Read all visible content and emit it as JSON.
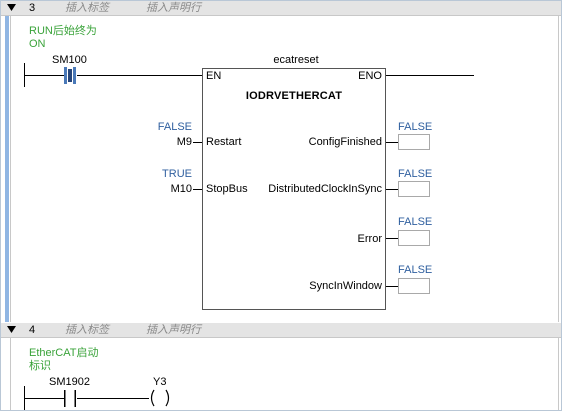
{
  "rungs": [
    {
      "number": "3",
      "insert_label": "插入标签",
      "insert_declaration": "插入声明行",
      "comment_line1": "RUN后始终为",
      "comment_line2": "ON",
      "contact": "SM100",
      "block": {
        "instance": "ecatreset",
        "type": "IODRVETHERCAT",
        "en": "EN",
        "eno": "ENO",
        "inputs": [
          {
            "pin": "Restart",
            "variable": "M9",
            "value": "FALSE"
          },
          {
            "pin": "StopBus",
            "variable": "M10",
            "value": "TRUE"
          }
        ],
        "outputs": [
          {
            "pin": "ConfigFinished",
            "value": "FALSE"
          },
          {
            "pin": "DistributedClockInSync",
            "value": "FALSE"
          },
          {
            "pin": "Error",
            "value": "FALSE"
          },
          {
            "pin": "SyncInWindow",
            "value": "FALSE"
          }
        ]
      }
    },
    {
      "number": "4",
      "insert_label": "插入标签",
      "insert_declaration": "插入声明行",
      "comment_line1": "EtherCAT启动",
      "comment_line2": "标识",
      "contact": "SM1902",
      "coil": "Y3",
      "coil_symbol": "( )"
    }
  ],
  "colors": {
    "comment": "#3aa33a",
    "value": "#2f5f9f",
    "header_bg": "#e4e4e4",
    "rung_bar": "#8fb5e3"
  },
  "icons": [
    "collapse-triangle-icon",
    "contact-icon",
    "coil-icon"
  ]
}
